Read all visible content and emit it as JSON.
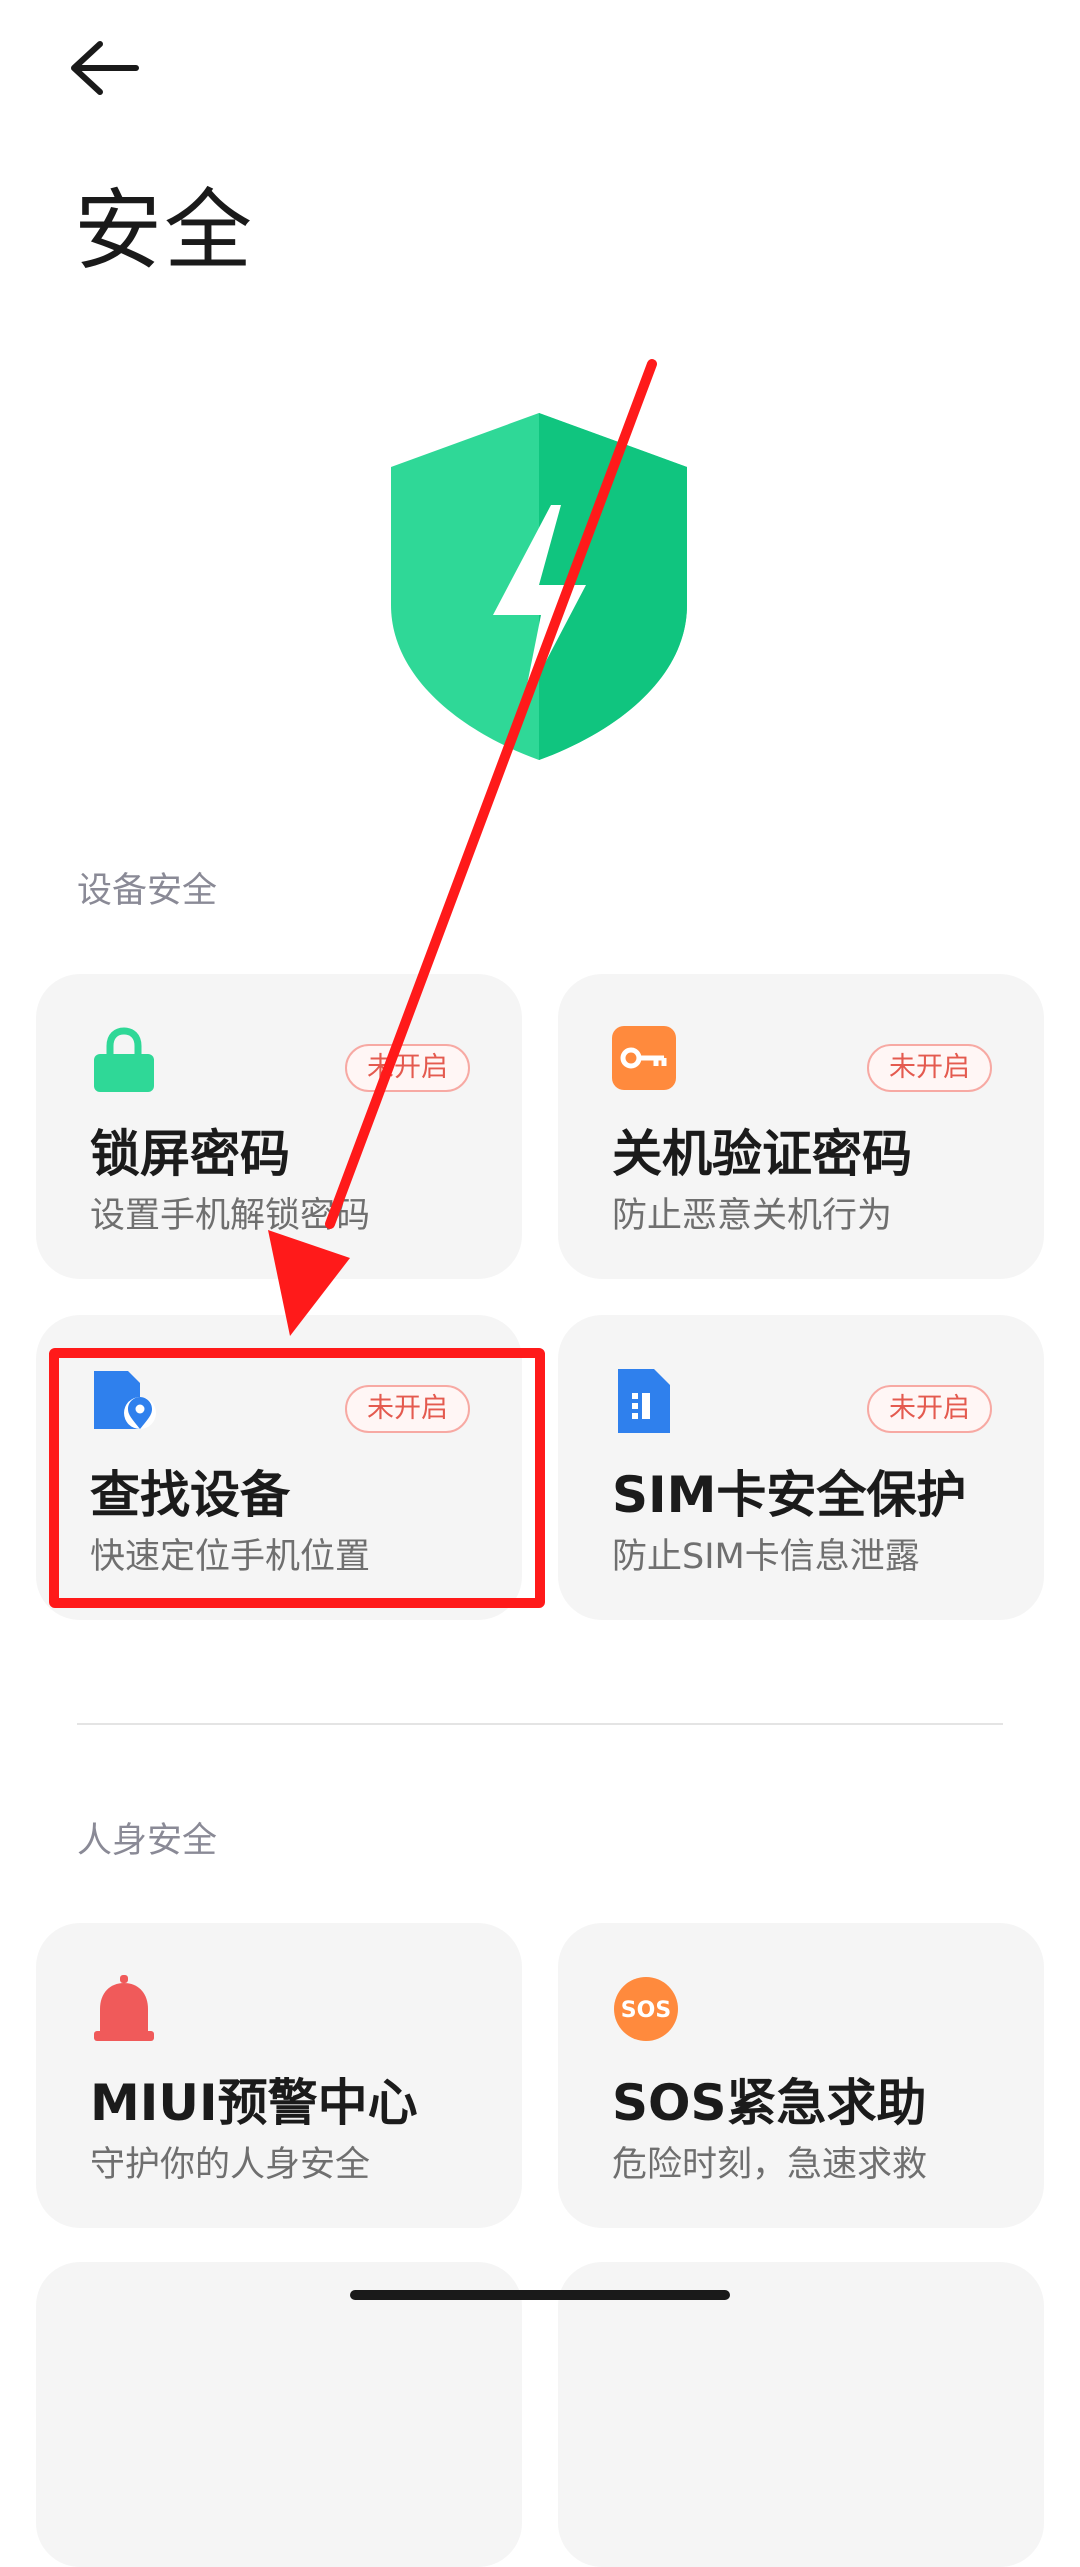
{
  "header": {
    "title": "安全"
  },
  "colors": {
    "accent_green": "#2fd897",
    "badge_red": "#e45a4f",
    "annotation_red": "#ff1a1a"
  },
  "sections": {
    "device": {
      "label": "设备安全"
    },
    "personal": {
      "label": "人身安全"
    }
  },
  "cards": {
    "lock_screen": {
      "title": "锁屏密码",
      "desc": "设置手机解锁密码",
      "badge": "未开启",
      "icon": "lock-icon"
    },
    "shutdown_verify": {
      "title": "关机验证密码",
      "desc": "防止恶意关机行为",
      "badge": "未开启",
      "icon": "key-icon"
    },
    "find_device": {
      "title": "查找设备",
      "desc": "快速定位手机位置",
      "badge": "未开启",
      "icon": "find-device-icon"
    },
    "sim_protect": {
      "title": "SIM卡安全保护",
      "desc": "防止SIM卡信息泄露",
      "badge": "未开启",
      "icon": "sim-card-icon"
    },
    "miui_alert": {
      "title": "MIUI预警中心",
      "desc": "守护你的人身安全",
      "icon": "alarm-siren-icon"
    },
    "sos": {
      "title": "SOS紧急求助",
      "desc": "危险时刻，急速求救",
      "icon": "sos-icon",
      "icon_text": "SOS"
    }
  }
}
